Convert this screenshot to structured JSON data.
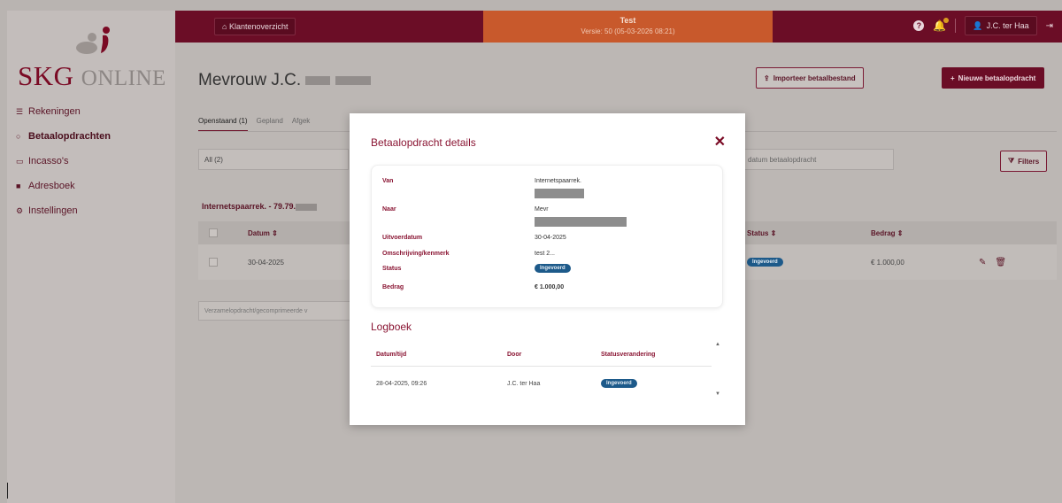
{
  "sidebar": {
    "logo_main": "SKG",
    "logo_sub": "ONLINE",
    "items": [
      {
        "icon": "list-icon",
        "glyph": "☰",
        "label": "Rekeningen"
      },
      {
        "icon": "circle-icon",
        "glyph": "○",
        "label": "Betaalopdrachten"
      },
      {
        "icon": "inbox-icon",
        "glyph": "▭",
        "label": "Incasso's"
      },
      {
        "icon": "book-icon",
        "glyph": "■",
        "label": "Adresboek"
      },
      {
        "icon": "gears-icon",
        "glyph": "⚙",
        "label": "Instellingen"
      }
    ]
  },
  "topbar": {
    "client_overview": "Klantenoverzicht",
    "env_title": "Test",
    "env_version": "Versie: 50 (05-03-2026 08:21)",
    "user": "J.C. ter Haa"
  },
  "page": {
    "title": "Mevrouw J.C.",
    "import_button": "Importeer betaalbestand",
    "new_button": "Nieuwe betaalopdracht",
    "tabs": [
      "Openstaand (1)",
      "Gepland",
      "Afgek"
    ],
    "select_value": "All (2)",
    "date_placeholder": "datum betaalopdracht",
    "filters": "Filters",
    "account": "Internetspaarrek. - 79.79.",
    "columns": {
      "date": "Datum ⇕",
      "status": "Status ⇕",
      "amount": "Bedrag ⇕"
    },
    "row": {
      "date": "30-04-2025",
      "status": "Ingevoerd",
      "amount": "€ 1.000,00"
    },
    "bulk_hint": "Verzamelopdracht/gecomprimeerde v"
  },
  "modal": {
    "title": "Betaalopdracht details",
    "details": [
      {
        "label": "Van",
        "value": "Internetspaarrek."
      },
      {
        "label": "Naar",
        "value": "Mevr"
      },
      {
        "label": "Uitvoerdatum",
        "value": "30-04-2025"
      },
      {
        "label": "Omschrijving/kenmerk",
        "value": "test 2..."
      },
      {
        "label": "Status",
        "value": "Ingevoerd"
      },
      {
        "label": "Bedrag",
        "value": "€ 1.000,00"
      }
    ],
    "log_title": "Logboek",
    "log_columns": [
      "Datum/tijd",
      "Door",
      "Statusverandering"
    ],
    "log_rows": [
      {
        "datetime": "28-04-2025, 09:26",
        "by": "J.C. ter Haa",
        "status": "Ingevoerd"
      }
    ]
  },
  "colors": {
    "brand": "#7a0a24",
    "env_banner": "#c8592c",
    "status_badge": "#1d5a8a"
  }
}
